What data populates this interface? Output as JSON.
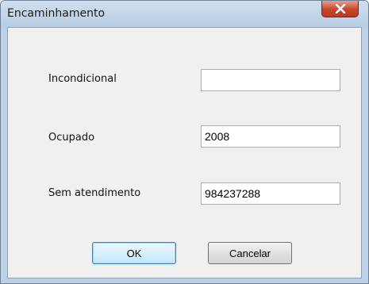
{
  "window": {
    "title": "Encaminhamento",
    "close_icon": "close-x-icon"
  },
  "form": {
    "fields": [
      {
        "label": "Incondicional",
        "value": ""
      },
      {
        "label": "Ocupado",
        "value": "2008"
      },
      {
        "label": "Sem atendimento",
        "value": "984237288"
      }
    ]
  },
  "buttons": {
    "ok_label": "OK",
    "cancel_label": "Cancelar"
  },
  "colors": {
    "close_button": "#c8452d",
    "frame": "#bcd0e6"
  }
}
